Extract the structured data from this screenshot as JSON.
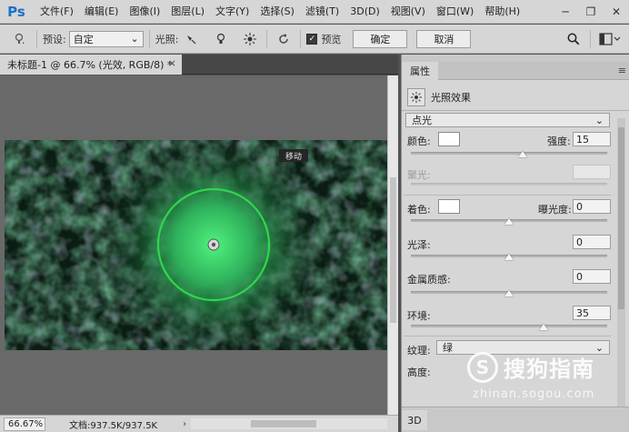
{
  "app": {
    "logo": "Ps"
  },
  "menu": [
    "文件(F)",
    "编辑(E)",
    "图像(I)",
    "图层(L)",
    "文字(Y)",
    "选择(S)",
    "滤镜(T)",
    "3D(D)",
    "视图(V)",
    "窗口(W)",
    "帮助(H)"
  ],
  "window_controls": {
    "minimize": "─",
    "restore": "❐",
    "close": "✕"
  },
  "options": {
    "preset_label": "预设:",
    "preset_value": "自定",
    "light_label": "光照:",
    "preview_label": "预览",
    "ok_label": "确定",
    "cancel_label": "取消"
  },
  "document": {
    "tab_title": "未标题-1 @ 66.7% (光效, RGB/8) *",
    "close": "×"
  },
  "canvas": {
    "tooltip": "移动"
  },
  "status": {
    "zoom": "66.67%",
    "doc_info": "文档:937.5K/937.5K",
    "arrow": "›"
  },
  "panel": {
    "tab": "属性",
    "menu": "≡",
    "filter_name": "光照效果",
    "light_type": "点光",
    "color_label": "颜色:",
    "intensity_label": "强度:",
    "intensity_value": "15",
    "intensity_level": 0.57,
    "hotspot_label": "聚光:",
    "hotspot_level": 0.5,
    "tint_label": "着色:",
    "exposure_label": "曝光度:",
    "exposure_value": "0",
    "exposure_level": 0.5,
    "gloss_label": "光泽:",
    "gloss_value": "0",
    "gloss_level": 0.5,
    "metallic_label": "金属质感:",
    "metallic_value": "0",
    "metallic_level": 0.5,
    "ambience_label": "环境:",
    "ambience_value": "35",
    "ambience_level": 0.675,
    "texture_label": "纹理:",
    "texture_value": "绿",
    "height_label": "高度:",
    "bottom_tab": "3D"
  },
  "watermark": {
    "brand": "搜狗指南",
    "url": "zhinan.sogou.com"
  },
  "colors": {
    "accent": "#1a73c4",
    "light_ring": "#2fd84a"
  }
}
